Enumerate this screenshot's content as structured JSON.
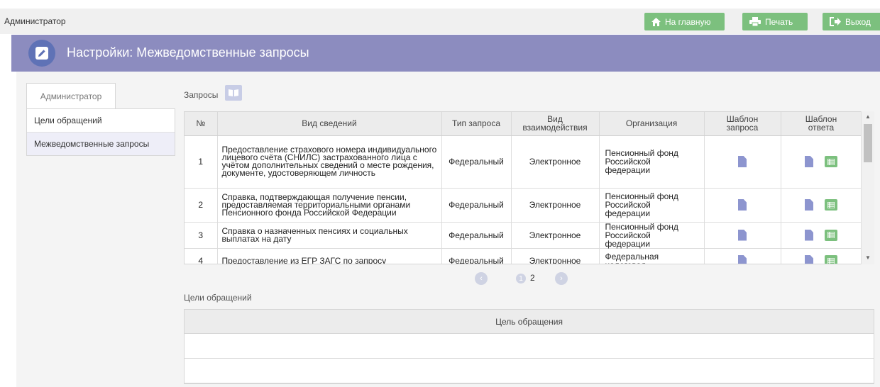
{
  "topbar": {
    "user": "Администратор",
    "home_label": "На главную",
    "print_label": "Печать",
    "exit_label": "Выход",
    "button_color": "#7cc07e"
  },
  "header": {
    "title": "Настройки: Межведомственные запросы",
    "bg_color": "#8c8cbf"
  },
  "sidebar": {
    "tab_label": "Администратор",
    "items": [
      {
        "label": "Цели обращений",
        "active": false
      },
      {
        "label": "Межведомственные запросы",
        "active": true
      }
    ]
  },
  "requests": {
    "title": "Запросы",
    "columns": [
      "№",
      "Вид сведений",
      "Тип запроса",
      "Вид взаимодействия",
      "Организация",
      "Шаблон запроса",
      "Шаблон ответа"
    ],
    "rows": [
      {
        "num": "1",
        "info": "Предоставление страхового номера индивидуального лицевого счёта (СНИЛС) застрахованного лица с учётом дополнительных сведений о месте рождения, документе, удостоверяющем личность",
        "type": "Федеральный",
        "interaction": "Электронное",
        "org": "Пенсионный фонд Российской федерации"
      },
      {
        "num": "2",
        "info": "Справка, подтверждающая получение пенсии, предоставляемая территориальными органами Пенсионного фонда Российской Федерации",
        "type": "Федеральный",
        "interaction": "Электронное",
        "org": "Пенсионный фонд Российской федерации"
      },
      {
        "num": "3",
        "info": "Справка о назначенных пенсиях и социальных выплатах на дату",
        "type": "Федеральный",
        "interaction": "Электронное",
        "org": "Пенсионный фонд Российской федерации"
      },
      {
        "num": "4",
        "info": "Предоставление из ЕГР ЗАГС по запросу",
        "type": "Федеральный",
        "interaction": "Электронное",
        "org": "Федеральная налоговая"
      }
    ]
  },
  "pager": {
    "pages": [
      "1",
      "2"
    ],
    "current": "1"
  },
  "goals": {
    "title": "Цели обращений",
    "column": "Цель обращения"
  }
}
